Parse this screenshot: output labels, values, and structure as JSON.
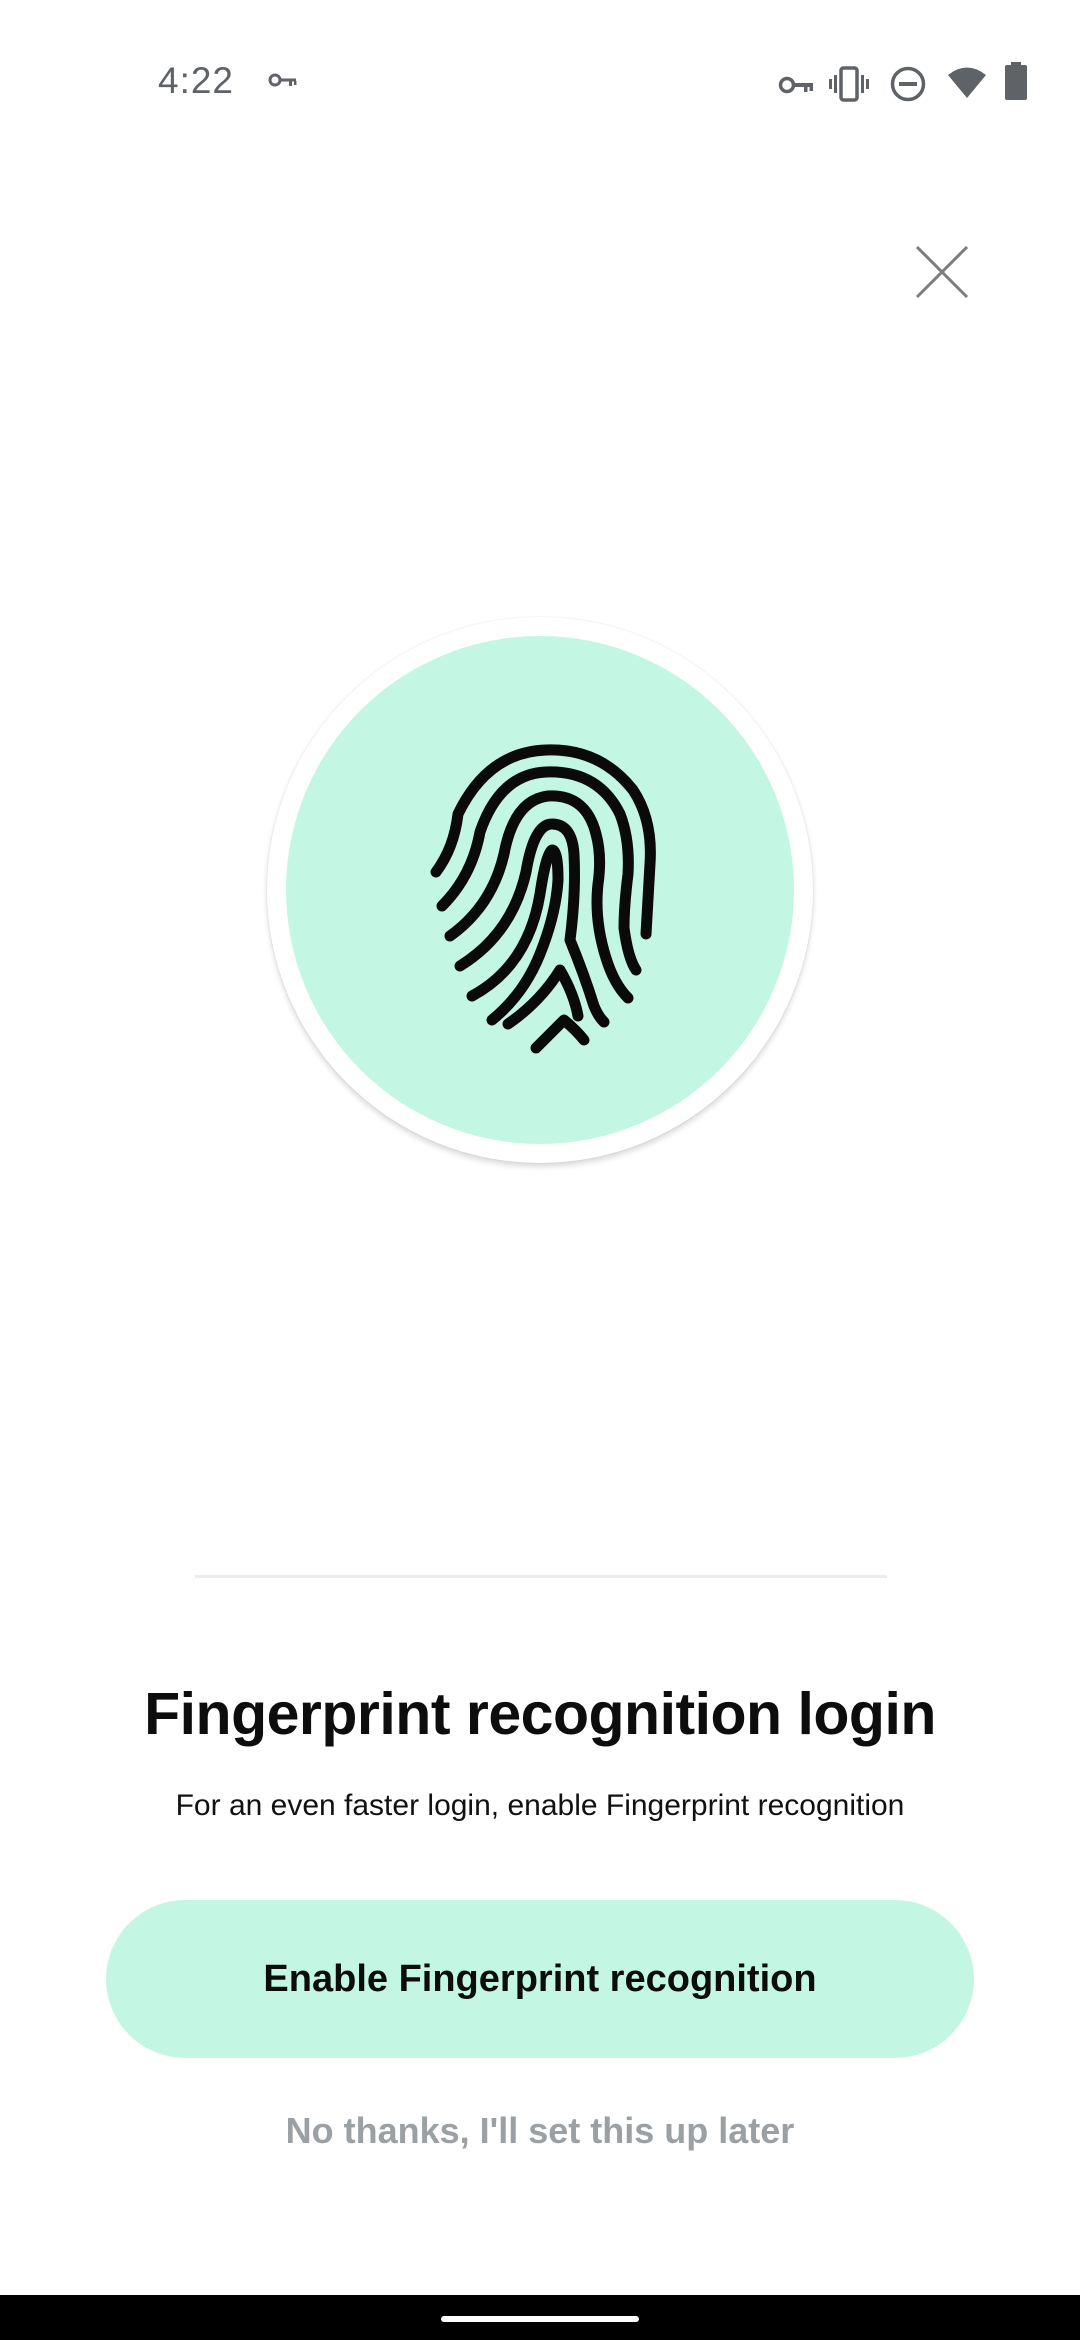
{
  "status_bar": {
    "time": "4:22",
    "left_icons": [
      "vpn-key-icon"
    ],
    "right_icons": [
      "vpn-key-icon",
      "vibrate-icon",
      "do-not-disturb-icon",
      "wifi-icon",
      "battery-icon"
    ]
  },
  "dialog": {
    "close_icon": "close-icon",
    "hero_icon": "fingerprint-icon",
    "title": "Fingerprint recognition login",
    "subtitle": "For an even faster login, enable Fingerprint recognition",
    "primary_button_label": "Enable Fingerprint recognition",
    "secondary_link_label": "No thanks, I'll set this up later"
  },
  "colors": {
    "accent_mint": "#c4f7e3",
    "text_primary": "#0d0d0d",
    "text_muted": "#9aa0a3",
    "status_gray": "#5f6368"
  }
}
